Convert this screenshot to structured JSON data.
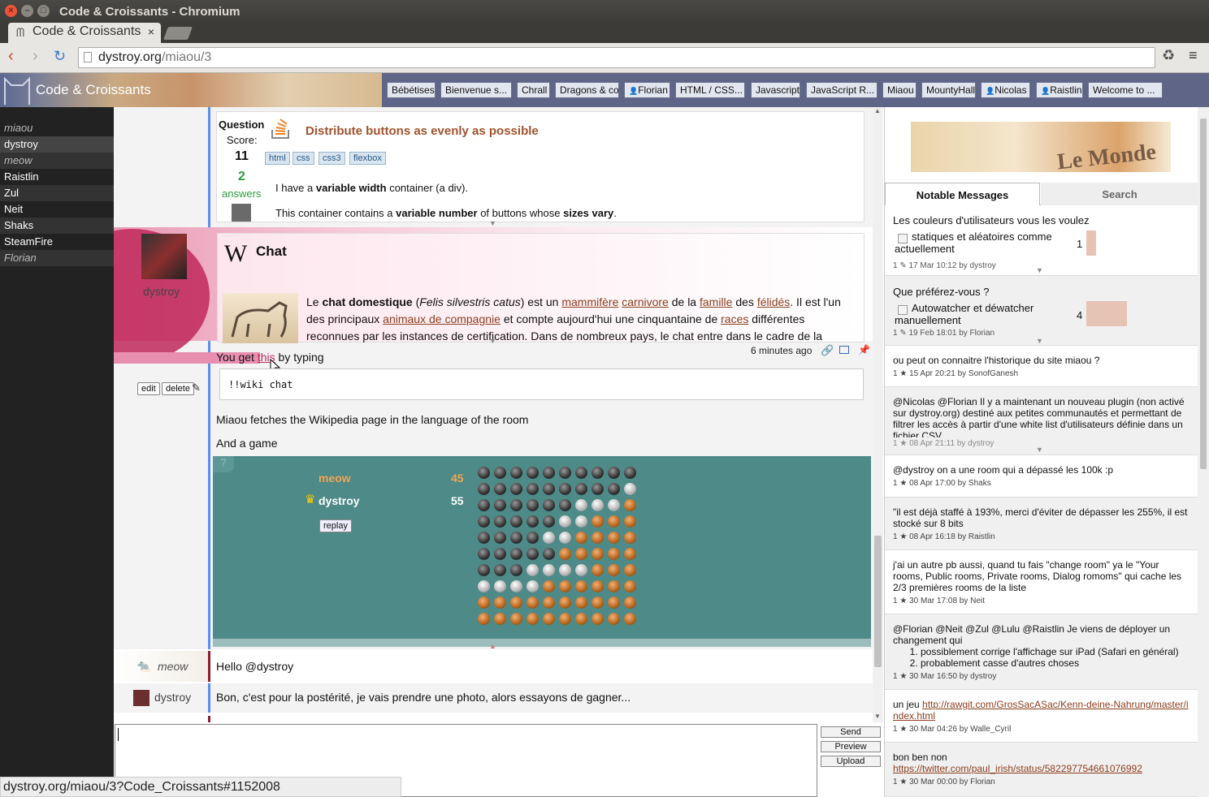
{
  "window": {
    "title": "Code & Croissants - Chromium"
  },
  "browser": {
    "tab_title": "Code & Croissants",
    "url_host": "dystroy.org",
    "url_path": "/miaou/3",
    "status_url": "dystroy.org/miaou/3?Code_Croissants#1152008"
  },
  "app": {
    "room_title": "Code & Croissants",
    "rooms": [
      "Bébétises",
      "Bienvenue s...",
      "Chrall",
      "Dragons & co",
      "Florian",
      "HTML / CSS...",
      "Javascript",
      "JavaScript R...",
      "Miaou",
      "MountyHall",
      "Nicolas",
      "Raistlin",
      "Welcome to ..."
    ]
  },
  "users": [
    "miaou",
    "dystroy",
    "meow",
    "Raistlin",
    "Zul",
    "Neit",
    "Shaks",
    "SteamFire",
    "Florian"
  ],
  "so_card": {
    "question_label": "Question",
    "score_label": "Score:",
    "score": "11",
    "answers_count": "2",
    "answers_label": "answers",
    "title": "Distribute buttons as evenly as possible",
    "tags": [
      "html",
      "css",
      "css3",
      "flexbox"
    ],
    "body_1_pre": "I have a ",
    "body_1_bold": "variable width",
    "body_1_post": " container (a div).",
    "body_2_pre": "This container contains a ",
    "body_2_bold": "variable number",
    "body_2_mid": " of buttons whose ",
    "body_2_bold2": "sizes vary",
    "body_2_post": "."
  },
  "wiki_card": {
    "title": "Chat",
    "author": "dystroy",
    "t1": "Le ",
    "t1b": "chat domestique",
    "t2": " (",
    "t2i": "Felis silvestris catus",
    "t3": ") est un ",
    "l1": "mammifère",
    "l2": "carnivore",
    "t4": " de la ",
    "l3": "famille",
    "t5": " des ",
    "l4": "félidés",
    "t6": ". Il est l'un",
    "t7": "des principaux ",
    "l5": "animaux de compagnie",
    "t8": " et compte aujourd'hui une cinquantaine de ",
    "l6": "races",
    "t9": " différentes",
    "t10": "reconnues par les instances de certification. Dans de nombreux pays, le chat entre dans le cadre de la"
  },
  "message_main": {
    "text_pre": "You get ",
    "text_link": "this",
    "text_post": " by typing",
    "time": "6 minutes ago",
    "edit": "edit",
    "delete": "delete",
    "code": "!!wiki chat",
    "line2": "Miaou fetches the Wikipedia page in the language of the room",
    "line3": "And a game"
  },
  "game": {
    "help": "?",
    "player1": "meow",
    "score1": "45",
    "player2": "dystroy",
    "score2": "55",
    "replay": "replay"
  },
  "messages_bottom": [
    {
      "author": "meow",
      "text": "Hello @dystroy"
    },
    {
      "author": "dystroy",
      "text": "Bon, c'est pour la postérité, je vais prendre une photo, alors essayons de gagner..."
    }
  ],
  "input": {
    "send": "Send",
    "preview": "Preview",
    "upload": "Upload"
  },
  "right_panel": {
    "tab_notable": "Notable Messages",
    "tab_search": "Search",
    "poll1": {
      "question": "Les couleurs d'utilisateurs vous les voulez",
      "option": "statiques et aléatoires comme actuellement",
      "count": "1",
      "meta": "1 ✎ 17 Mar 10:12 by dystroy"
    },
    "poll2": {
      "question": "Que préférez-vous ?",
      "option": "Autowatcher et déwatcher manuellement",
      "count": "4",
      "meta": "1 ✎ 19 Feb 18:01 by Florian"
    },
    "notes": [
      {
        "text": "ou peut on connaitre l'historique du site miaou ?",
        "meta": "1 ★ 15 Apr 20:21 by SonofGanesh"
      },
      {
        "text": "@Nicolas @Florian Il y a maintenant un nouveau plugin (non activé sur dystroy.org) destiné aux petites communautés et permettant de filtrer les accès à partir d'une white list d'utilisateurs définie dans un fichier CSV.",
        "meta": "1 ★ 08 Apr 21:11 by dystroy"
      },
      {
        "text": "@dystroy on a une room qui a dépassé les 100k :p",
        "meta": "1 ★ 08 Apr 17:00 by Shaks"
      },
      {
        "text": "\"il est déjà staffé à 193%, merci d'éviter de dépasser les 255%, il est stocké sur 8 bits",
        "meta": "1 ★ 08 Apr 16:18 by Raistlin"
      },
      {
        "text": "j'ai un autre pb aussi, quand tu fais \"change room\" ya le \"Your rooms, Public rooms, Private rooms, Dialog romoms\" qui cache les 2/3 premières rooms de la liste",
        "meta": "1 ★ 30 Mar 17:08 by Neit"
      },
      {
        "text": "@Florian @Neit @Zul @Lulu @Raistlin Je viens de déployer un changement qui",
        "li1": "possiblement corrige l'affichage sur iPad (Safari en général)",
        "li2": "probablement casse d'autres choses",
        "meta": "1 ★ 30 Mar 16:50 by dystroy"
      },
      {
        "text": "un jeu ",
        "link": "http://rawgit.com/GrosSacASac/Kenn-deine-Nahrung/master/index.html",
        "meta": "1 ★ 30 Mar 04:26 by Walle_Cyril"
      },
      {
        "text": "bon ben non",
        "link": "https://twitter.com/paul_irish/status/582297754661076992",
        "meta": "1 ★ 30 Mar 00:00 by Florian"
      }
    ]
  },
  "colors": {
    "accent_blue": "#5b8def",
    "brand": "#5f6587",
    "game_bg": "#4d8a88",
    "link": "#8b3e1e",
    "pink": "#e05a8a"
  },
  "game_board": [
    "dddddddddd",
    "dddddddddw",
    "ddddddwwwo",
    "dddddwwooo",
    "ddddwwoooo",
    "dddddooooo",
    "dddwwwwooo",
    "wwwwoooooo",
    "oooooooooo",
    "oooooooooo"
  ]
}
